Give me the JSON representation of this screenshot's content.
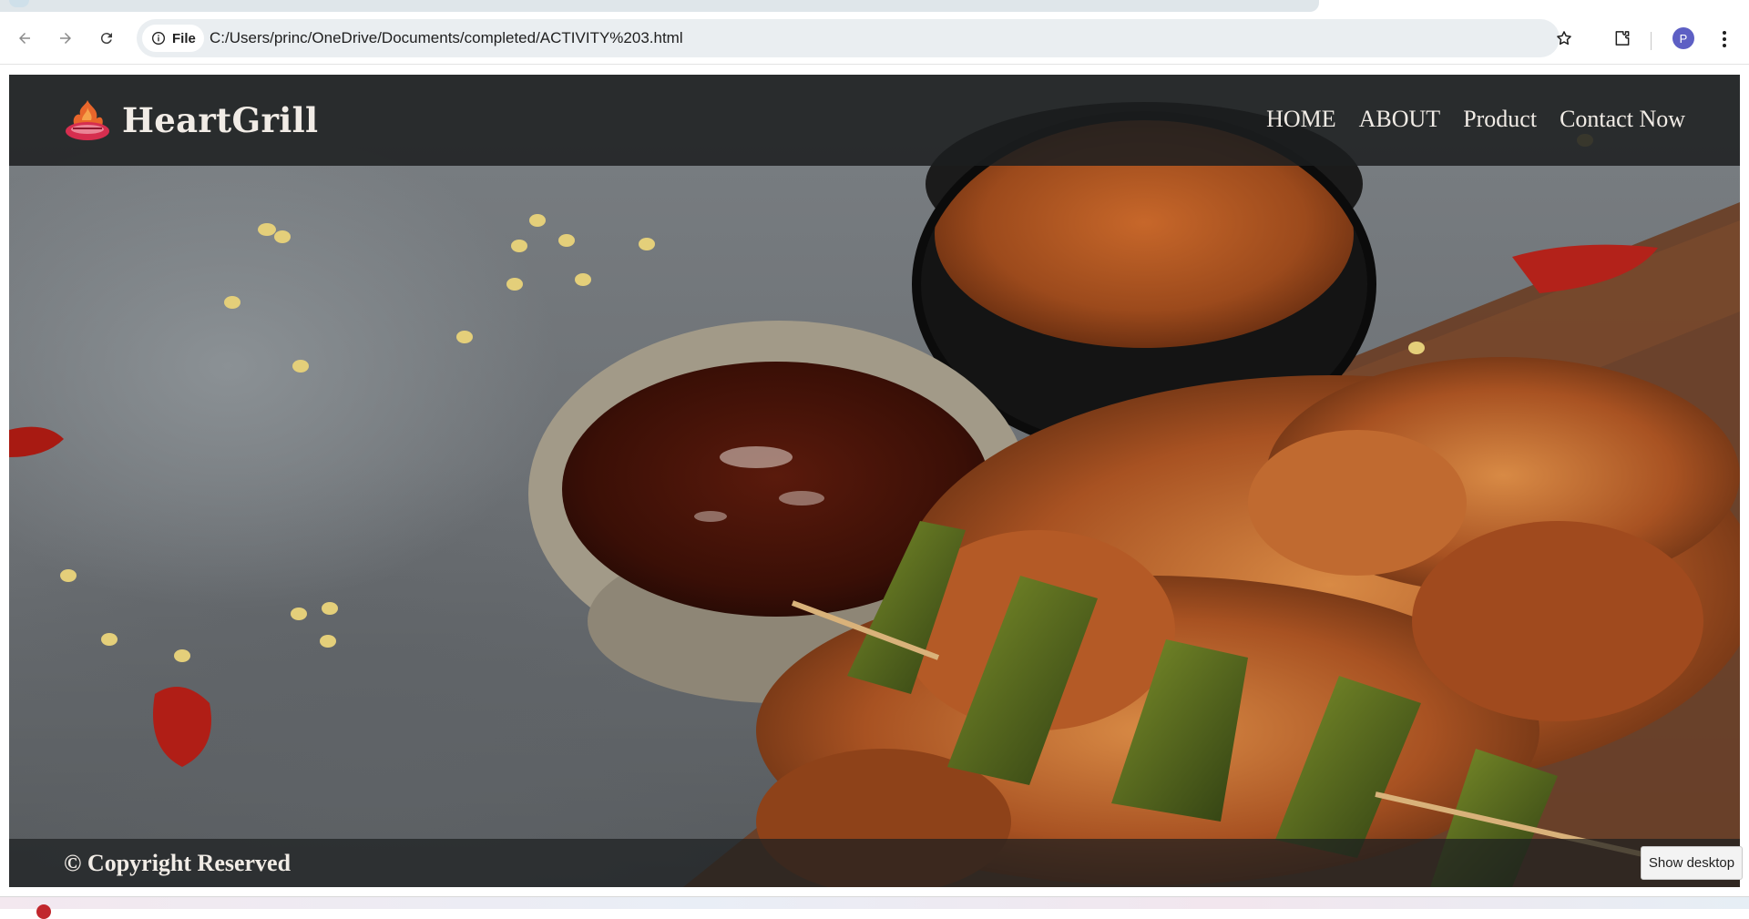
{
  "browser": {
    "file_chip_label": "File",
    "url": "C:/Users/princ/OneDrive/Documents/completed/ACTIVITY%203.html",
    "avatar_letter": "P",
    "icons": [
      "back-arrow-icon",
      "forward-arrow-icon",
      "reload-icon",
      "info-icon",
      "star-icon",
      "extensions-icon",
      "more-vert-icon"
    ]
  },
  "site": {
    "brand": "HeartGrill",
    "nav": [
      {
        "label": "HOME"
      },
      {
        "label": "ABOUT"
      },
      {
        "label": "Product"
      },
      {
        "label": "Contact Now"
      }
    ],
    "footer_text": "© Copyright Reserved",
    "colors": {
      "bar_bg": "#1c1e20",
      "text": "#f1ece6",
      "logo_red": "#d62e4f",
      "logo_flame": "#e8662b"
    }
  },
  "os": {
    "tooltip": "Show desktop"
  }
}
